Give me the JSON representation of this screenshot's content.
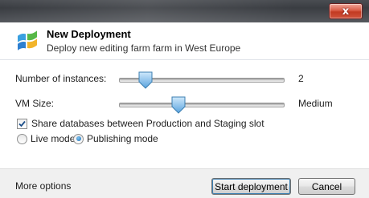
{
  "window": {
    "close_glyph": "x"
  },
  "header": {
    "title": "New Deployment",
    "subtitle": "Deploy new editing farm farm in West Europe"
  },
  "settings": {
    "instances": {
      "label": "Number of instances:",
      "value": "2",
      "level": 0.16
    },
    "vm_size": {
      "label": "VM Size:",
      "value": "Medium",
      "level": 0.36
    },
    "share_databases": {
      "label": "Share databases between Production and Staging slot",
      "checked": true
    },
    "mode": {
      "options": [
        "Live mode",
        "Publishing mode"
      ],
      "selected": "Publishing mode"
    }
  },
  "footer": {
    "more_options": "More options",
    "start_label": "Start deployment",
    "cancel_label": "Cancel"
  },
  "colors": {
    "accent": "#3c7fb1",
    "thumb_fill": "#7fb8e8",
    "close_red": "#c23a22"
  },
  "icons": {
    "app": "windows-logo-icon",
    "checkbox": "checkmark-icon"
  }
}
